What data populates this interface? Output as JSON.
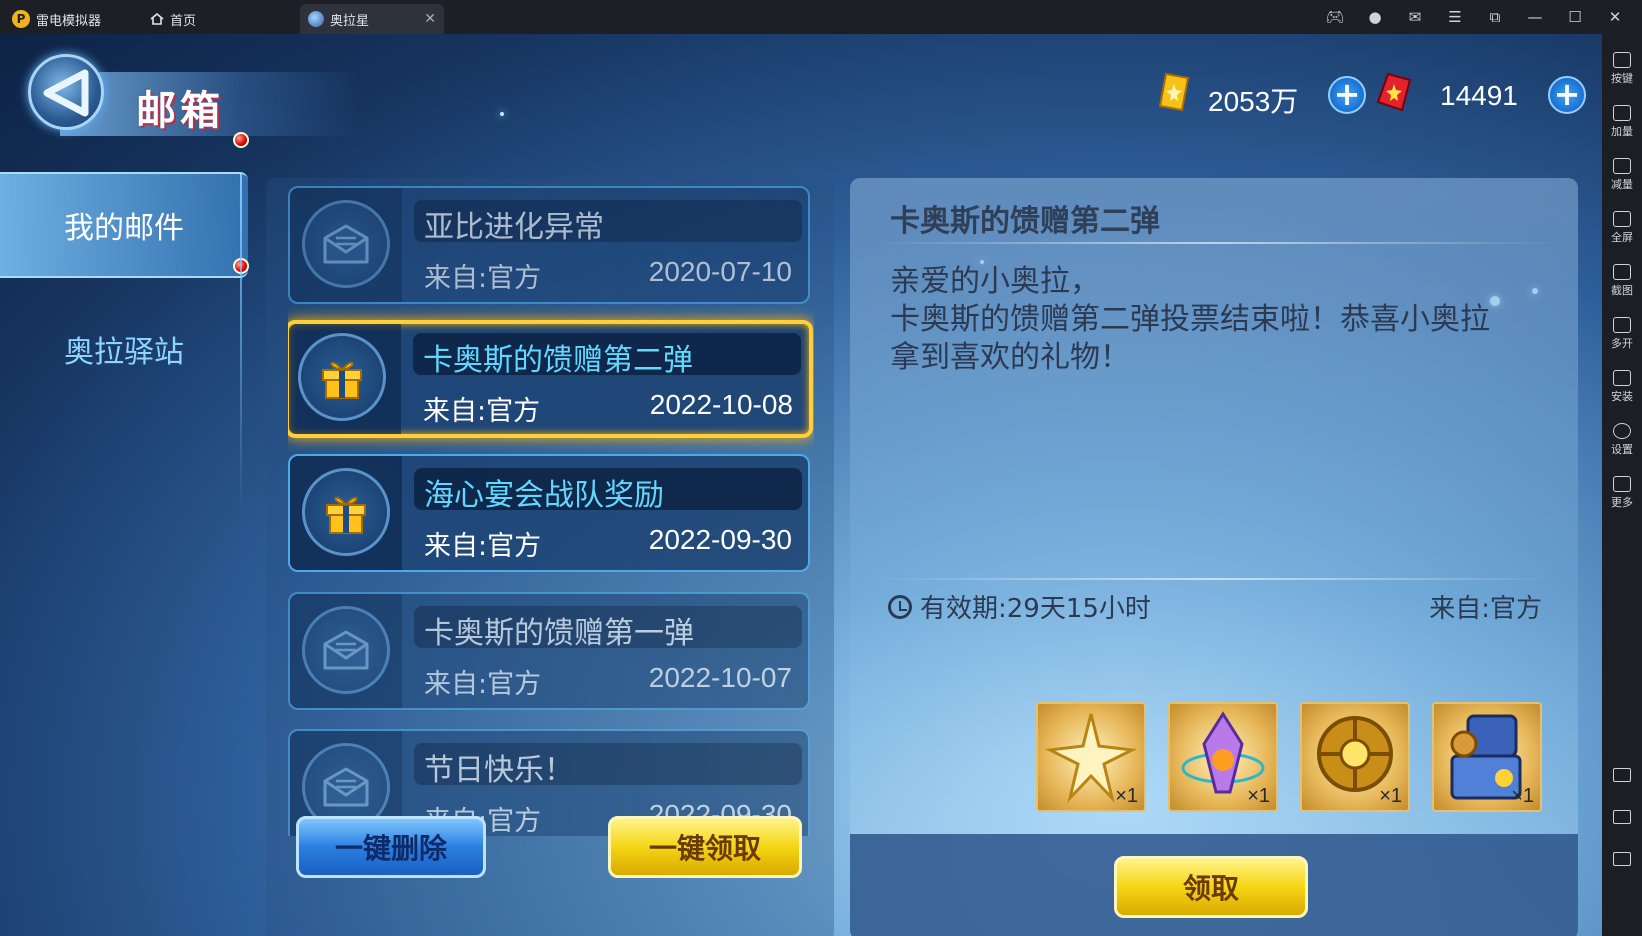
{
  "emulator": {
    "app_name": "雷电模拟器",
    "tabs": [
      {
        "label": "首页"
      },
      {
        "label": "奥拉星"
      }
    ],
    "sidebar": [
      {
        "label": "按键"
      },
      {
        "label": "加量"
      },
      {
        "label": "减量"
      },
      {
        "label": "全屏"
      },
      {
        "label": "截图"
      },
      {
        "label": "多开"
      },
      {
        "label": "安装"
      },
      {
        "label": "设置"
      },
      {
        "label": "更多"
      }
    ]
  },
  "header": {
    "title": "邮箱",
    "gold": "2053万",
    "diamonds": "14491"
  },
  "nav": {
    "items": [
      {
        "label": "我的邮件",
        "active": true
      },
      {
        "label": "奥拉驿站",
        "active": false
      }
    ]
  },
  "mails": [
    {
      "title": "亚比进化异常",
      "from": "来自:官方",
      "date": "2020-07-10",
      "icon": "envelope-icon",
      "state": "read"
    },
    {
      "title": "卡奥斯的馈赠第二弹",
      "from": "来自:官方",
      "date": "2022-10-08",
      "icon": "gift-icon",
      "state": "selected"
    },
    {
      "title": "海心宴会战队奖励",
      "from": "来自:官方",
      "date": "2022-09-30",
      "icon": "gift-icon",
      "state": "new"
    },
    {
      "title": "卡奥斯的馈赠第一弹",
      "from": "来自:官方",
      "date": "2022-10-07",
      "icon": "envelope-icon",
      "state": "read"
    },
    {
      "title": "节日快乐！",
      "from": "来自:官方",
      "date": "2022-09-30",
      "icon": "envelope-icon",
      "state": "read"
    }
  ],
  "buttons": {
    "delete_all": "一键删除",
    "claim_all": "一键领取",
    "claim": "领取"
  },
  "detail": {
    "title": "卡奥斯的馈赠第二弹",
    "body_lines": [
      "亲爱的小奥拉，",
      "卡奥斯的馈赠第二弹投票结束啦！恭喜小奥拉",
      "拿到喜欢的礼物！"
    ],
    "validity": "有效期:29天15小时",
    "from": "来自:官方",
    "rewards": [
      {
        "icon": "gold-star-icon",
        "qty": "×1"
      },
      {
        "icon": "crystal-icon",
        "qty": "×1"
      },
      {
        "icon": "golden-orb-icon",
        "qty": "×1"
      },
      {
        "icon": "treasure-chest-icon",
        "qty": "×1"
      }
    ]
  },
  "colors": {
    "accent_cyan": "#62d8ff",
    "selected_border": "#ffcf3a",
    "button_yellow": "#f5d514",
    "button_blue": "#2b7fe0"
  }
}
